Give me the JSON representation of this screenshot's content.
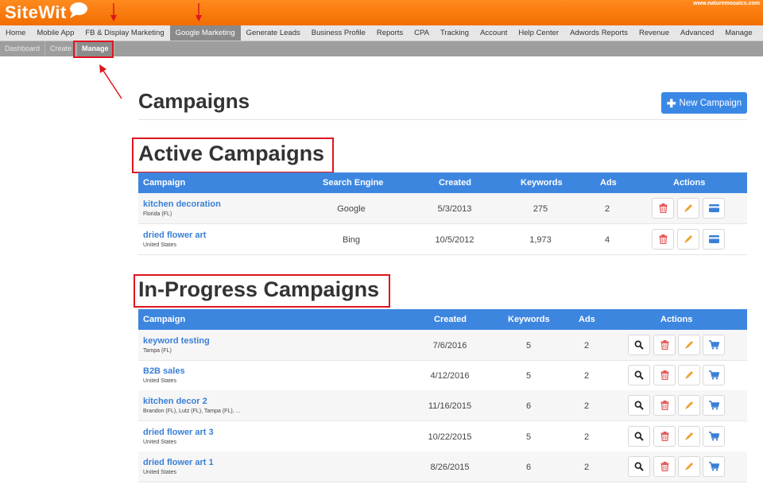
{
  "brand": {
    "logo_text": "SiteWit",
    "site_url": "www.naturemosaics.com"
  },
  "nav": {
    "items": [
      "Home",
      "Mobile App",
      "FB & Display Marketing",
      "Google Marketing",
      "Generate Leads",
      "Business Profile",
      "Reports",
      "CPA",
      "Tracking",
      "Account",
      "Help Center",
      "Adwords Reports",
      "Revenue",
      "Advanced",
      "Manage"
    ],
    "active": "Google Marketing"
  },
  "subnav": {
    "items": [
      "Dashboard",
      "Create",
      "Manage"
    ],
    "active": "Manage"
  },
  "page": {
    "title": "Campaigns",
    "new_button": "New Campaign"
  },
  "active_section": {
    "title": "Active Campaigns",
    "headers": [
      "Campaign",
      "Search Engine",
      "Created",
      "Keywords",
      "Ads",
      "Actions"
    ],
    "rows": [
      {
        "name": "kitchen decoration",
        "location": "Florida (FL)",
        "engine": "Google",
        "created": "5/3/2013",
        "keywords": "275",
        "ads": "2"
      },
      {
        "name": "dried flower art",
        "location": "United States",
        "engine": "Bing",
        "created": "10/5/2012",
        "keywords": "1,973",
        "ads": "4"
      }
    ]
  },
  "progress_section": {
    "title": "In-Progress Campaigns",
    "headers": [
      "Campaign",
      "Created",
      "Keywords",
      "Ads",
      "Actions"
    ],
    "rows": [
      {
        "name": "keyword testing",
        "location": "Tampa (FL)",
        "created": "7/6/2016",
        "keywords": "5",
        "ads": "2"
      },
      {
        "name": "B2B sales",
        "location": "United States",
        "created": "4/12/2016",
        "keywords": "5",
        "ads": "2"
      },
      {
        "name": "kitchen decor 2",
        "location": "Brandon (FL), Lutz (FL), Tampa (FL), ...",
        "created": "11/16/2015",
        "keywords": "6",
        "ads": "2"
      },
      {
        "name": "dried flower art 3",
        "location": "United States",
        "created": "10/22/2015",
        "keywords": "5",
        "ads": "2"
      },
      {
        "name": "dried flower art 1",
        "location": "United States",
        "created": "8/26/2015",
        "keywords": "6",
        "ads": "2"
      }
    ]
  },
  "colors": {
    "brand_orange": "#f57c00",
    "primary_blue": "#3d86e0",
    "link_blue": "#3a7fd6",
    "delete_red": "#e05555",
    "edit_orange": "#f0a030",
    "highlight_red": "#e0141e"
  },
  "icons": {
    "search": "magnifier-icon",
    "delete": "trash-icon",
    "edit": "pencil-icon",
    "card": "credit-card-icon",
    "cart": "cart-icon",
    "plus": "plus-icon"
  }
}
